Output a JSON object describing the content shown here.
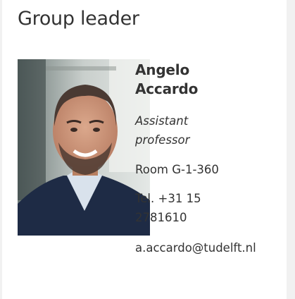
{
  "section": {
    "title": "Group leader"
  },
  "person": {
    "name": "Angelo Accardo",
    "role": "Assistant professor",
    "room": "Room G-1-360",
    "phone": "Tel. +31 15 2781610",
    "email": "a.accardo@tudelft.nl",
    "photo_icon": "person-photo"
  }
}
